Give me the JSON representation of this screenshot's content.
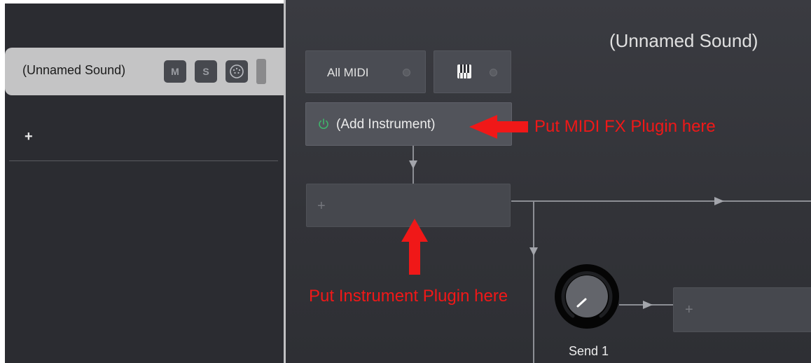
{
  "track_list": {
    "track_name": "(Unnamed Sound)",
    "mute_label": "M",
    "solo_label": "S",
    "add_label": "+"
  },
  "sound_panel": {
    "title": "(Unnamed Sound)",
    "midi_input_label": "All MIDI",
    "add_instrument_label": "(Add Instrument)",
    "empty_slot_label": "+",
    "send_label": "Send 1"
  },
  "annotations": {
    "midi_fx": "Put MIDI FX Plugin here",
    "instrument": "Put Instrument Plugin here"
  },
  "icons": {
    "midi_port": "midi-port-icon",
    "keyboard": "keyboard-icon",
    "power": "power-icon",
    "knob": "knob-icon"
  },
  "colors": {
    "annotation_red": "#f01818",
    "power_green": "#3fb56b",
    "panel_bg": "#3a3b41",
    "sidebar_bg": "#2b2c31",
    "selected_track": "#c4c4c5"
  }
}
